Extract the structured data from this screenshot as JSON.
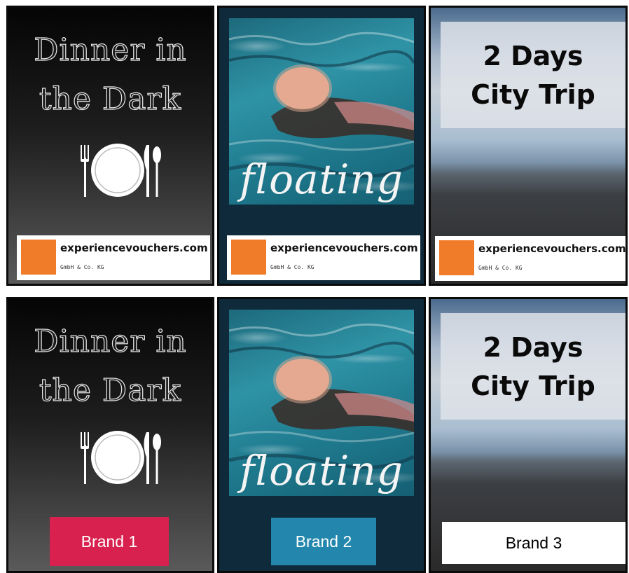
{
  "cards": {
    "dinner": {
      "title_line1": "Dinner in",
      "title_line2": "the Dark",
      "cutlery_icon": "plate-fork-knife-spoon-icon"
    },
    "floating": {
      "title": "floating",
      "image": "person-floating-in-pool"
    },
    "city": {
      "title_line1": "2 Days",
      "title_line2": "City Trip",
      "image": "city-skyline-aerial"
    }
  },
  "generic_logo": {
    "name": "experiencevouchers.com",
    "subtitle": "GmbH & Co. KG",
    "accent_color": "#f07c2a"
  },
  "brands": [
    {
      "label": "Brand 1",
      "bg_color": "#d8214f",
      "text_color": "#ffffff"
    },
    {
      "label": "Brand 2",
      "bg_color": "#2387ad",
      "text_color": "#ffffff"
    },
    {
      "label": "Brand 3",
      "bg_color": "#ffffff",
      "text_color": "#000000"
    }
  ]
}
